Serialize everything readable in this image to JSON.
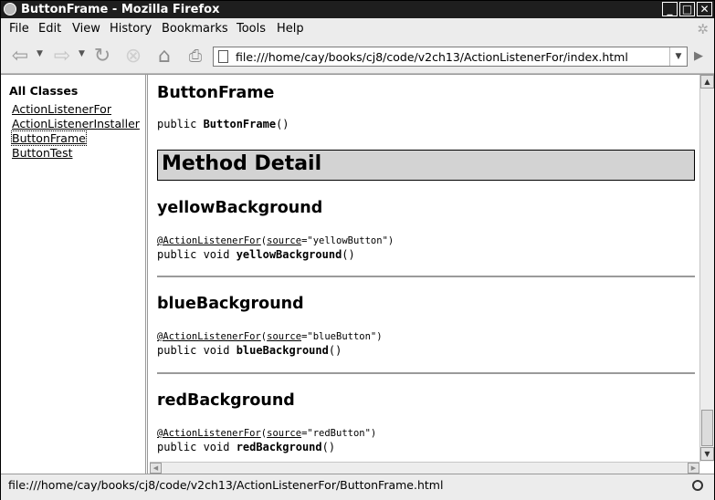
{
  "window": {
    "title": "ButtonFrame - Mozilla Firefox"
  },
  "menu": {
    "file": "File",
    "edit": "Edit",
    "view": "View",
    "history": "History",
    "bookmarks": "Bookmarks",
    "tools": "Tools",
    "help": "Help"
  },
  "toolbar": {
    "url": "file:///home/cay/books/cj8/code/v2ch13/ActionListenerFor/index.html",
    "icons": [
      "back-icon",
      "forward-icon",
      "reload-icon",
      "stop-icon",
      "home-icon",
      "print-icon",
      "go-icon"
    ]
  },
  "left_frame": {
    "heading": "All Classes",
    "classes": [
      "ActionListenerFor",
      "ActionListenerInstaller",
      "ButtonFrame",
      "ButtonTest"
    ]
  },
  "doc": {
    "ctor_heading": "ButtonFrame",
    "ctor_sig_prefix": "public ",
    "ctor_sig_name": "ButtonFrame",
    "ctor_sig_suffix": "()",
    "method_detail": "Method Detail",
    "methods": [
      {
        "name": "yellowBackground",
        "anno_name": "@ActionListenerFor",
        "anno_param": "source",
        "anno_value": "=\"yellowButton\")",
        "sig_prefix": "public void ",
        "sig_suffix": "()"
      },
      {
        "name": "blueBackground",
        "anno_name": "@ActionListenerFor",
        "anno_param": "source",
        "anno_value": "=\"blueButton\")",
        "sig_prefix": "public void ",
        "sig_suffix": "()"
      },
      {
        "name": "redBackground",
        "anno_name": "@ActionListenerFor",
        "anno_param": "source",
        "anno_value": "=\"redButton\")",
        "sig_prefix": "public void ",
        "sig_suffix": "()"
      }
    ]
  },
  "status": {
    "text": "file:///home/cay/books/cj8/code/v2ch13/ActionListenerFor/ButtonFrame.html"
  }
}
